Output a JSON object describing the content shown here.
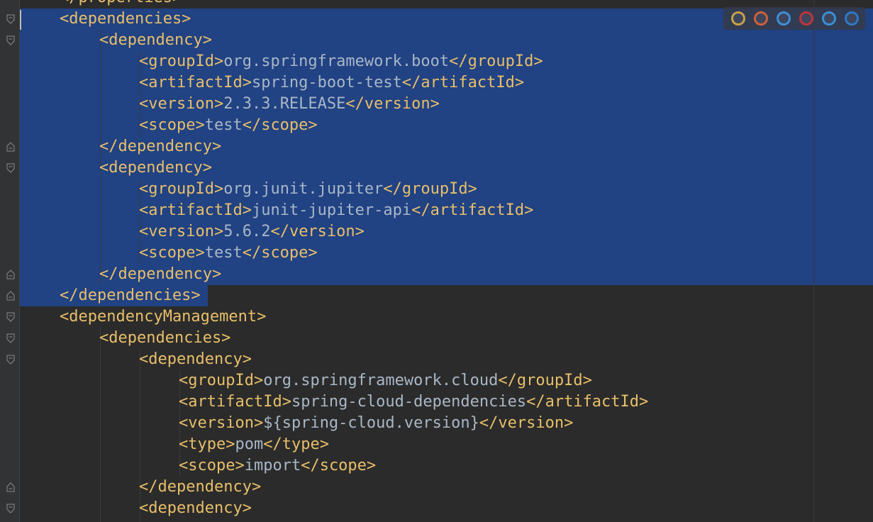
{
  "editor": {
    "colors": {
      "background": "#2b2b2b",
      "selection": "#214283",
      "tag": "#e8bf6a",
      "text": "#a9b7c6",
      "gutter": "#313335"
    },
    "lines": [
      {
        "indent": 1,
        "parts": [
          {
            "t": "tag",
            "v": "</properties>"
          }
        ]
      },
      {
        "indent": 1,
        "parts": [
          {
            "t": "tag",
            "v": "<dependencies>"
          }
        ]
      },
      {
        "indent": 2,
        "parts": [
          {
            "t": "tag",
            "v": "<dependency>"
          }
        ]
      },
      {
        "indent": 3,
        "parts": [
          {
            "t": "tag",
            "v": "<groupId>"
          },
          {
            "t": "txt",
            "v": "org.springframework.boot"
          },
          {
            "t": "tag",
            "v": "</groupId>"
          }
        ]
      },
      {
        "indent": 3,
        "parts": [
          {
            "t": "tag",
            "v": "<artifactId>"
          },
          {
            "t": "txt",
            "v": "spring-boot-test"
          },
          {
            "t": "tag",
            "v": "</artifactId>"
          }
        ]
      },
      {
        "indent": 3,
        "parts": [
          {
            "t": "tag",
            "v": "<version>"
          },
          {
            "t": "txt",
            "v": "2.3.3.RELEASE"
          },
          {
            "t": "tag",
            "v": "</version>"
          }
        ]
      },
      {
        "indent": 3,
        "parts": [
          {
            "t": "tag",
            "v": "<scope>"
          },
          {
            "t": "txt",
            "v": "test"
          },
          {
            "t": "tag",
            "v": "</scope>"
          }
        ]
      },
      {
        "indent": 2,
        "parts": [
          {
            "t": "tag",
            "v": "</dependency>"
          }
        ]
      },
      {
        "indent": 2,
        "parts": [
          {
            "t": "tag",
            "v": "<dependency>"
          }
        ]
      },
      {
        "indent": 3,
        "parts": [
          {
            "t": "tag",
            "v": "<groupId>"
          },
          {
            "t": "txt",
            "v": "org.junit.jupiter"
          },
          {
            "t": "tag",
            "v": "</groupId>"
          }
        ]
      },
      {
        "indent": 3,
        "parts": [
          {
            "t": "tag",
            "v": "<artifactId>"
          },
          {
            "t": "txt",
            "v": "junit-jupiter-api"
          },
          {
            "t": "tag",
            "v": "</artifactId>"
          }
        ]
      },
      {
        "indent": 3,
        "parts": [
          {
            "t": "tag",
            "v": "<version>"
          },
          {
            "t": "txt",
            "v": "5.6.2"
          },
          {
            "t": "tag",
            "v": "</version>"
          }
        ]
      },
      {
        "indent": 3,
        "parts": [
          {
            "t": "tag",
            "v": "<scope>"
          },
          {
            "t": "txt",
            "v": "test"
          },
          {
            "t": "tag",
            "v": "</scope>"
          }
        ]
      },
      {
        "indent": 2,
        "parts": [
          {
            "t": "tag",
            "v": "</dependency>"
          }
        ]
      },
      {
        "indent": 1,
        "parts": [
          {
            "t": "tag",
            "v": "</dependencies>"
          }
        ]
      },
      {
        "indent": 1,
        "parts": [
          {
            "t": "tag",
            "v": "<dependencyManagement>"
          }
        ]
      },
      {
        "indent": 2,
        "parts": [
          {
            "t": "tag",
            "v": "<dependencies>"
          }
        ]
      },
      {
        "indent": 3,
        "parts": [
          {
            "t": "tag",
            "v": "<dependency>"
          }
        ]
      },
      {
        "indent": 4,
        "parts": [
          {
            "t": "tag",
            "v": "<groupId>"
          },
          {
            "t": "txt",
            "v": "org.springframework.cloud"
          },
          {
            "t": "tag",
            "v": "</groupId>"
          }
        ]
      },
      {
        "indent": 4,
        "parts": [
          {
            "t": "tag",
            "v": "<artifactId>"
          },
          {
            "t": "txt",
            "v": "spring-cloud-dependencies"
          },
          {
            "t": "tag",
            "v": "</artifactId>"
          }
        ]
      },
      {
        "indent": 4,
        "parts": [
          {
            "t": "tag",
            "v": "<version>"
          },
          {
            "t": "txt",
            "v": "${spring-cloud.version}"
          },
          {
            "t": "tag",
            "v": "</version>"
          }
        ]
      },
      {
        "indent": 4,
        "parts": [
          {
            "t": "tag",
            "v": "<type>"
          },
          {
            "t": "txt",
            "v": "pom"
          },
          {
            "t": "tag",
            "v": "</type>"
          }
        ]
      },
      {
        "indent": 4,
        "parts": [
          {
            "t": "tag",
            "v": "<scope>"
          },
          {
            "t": "txt",
            "v": "import"
          },
          {
            "t": "tag",
            "v": "</scope>"
          }
        ]
      },
      {
        "indent": 3,
        "parts": [
          {
            "t": "tag",
            "v": "</dependency>"
          }
        ]
      },
      {
        "indent": 3,
        "parts": [
          {
            "t": "tag",
            "v": "<dependency>"
          }
        ]
      }
    ]
  },
  "browser_bar": {
    "icons": [
      {
        "name": "chrome-icon",
        "color": "#c8a046"
      },
      {
        "name": "firefox-icon",
        "color": "#d0603a"
      },
      {
        "name": "safari-icon",
        "color": "#3d8fd8"
      },
      {
        "name": "opera-icon",
        "color": "#c0343c"
      },
      {
        "name": "ie-icon",
        "color": "#3a8fd8"
      },
      {
        "name": "edge-icon",
        "color": "#2f78c8"
      }
    ]
  }
}
